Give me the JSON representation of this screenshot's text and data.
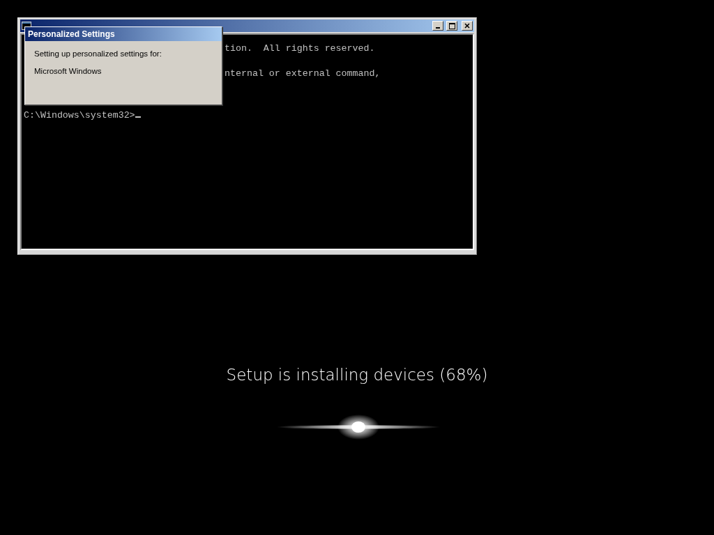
{
  "console_window": {
    "lines": [
      {
        "text": "tion.  All rights reserved.",
        "kind": "output"
      },
      {
        "text": "nternal or external command,",
        "kind": "output"
      },
      {
        "text": "C:\\Windows\\system32>",
        "kind": "prompt"
      }
    ]
  },
  "dialog": {
    "title": "Personalized Settings",
    "message": "Setting up personalized settings for:",
    "item": "Microsoft Windows"
  },
  "setup": {
    "status": "Setup is installing devices (68%)"
  }
}
